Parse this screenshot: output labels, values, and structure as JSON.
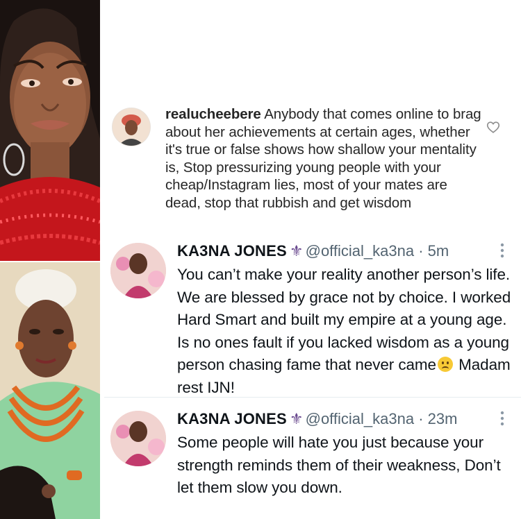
{
  "ig_comment": {
    "username": "realucheebere",
    "text": "Anybody that comes online to brag about her achievements at certain ages, whether it's true or false shows how shallow your mentality is, Stop pressurizing young people with your cheap/Instagram lies, most of your mates are dead, stop that rubbish and get wisdom"
  },
  "tweets": [
    {
      "name": "KA3NA JONES",
      "verified_glyph": "⚜",
      "handle": "@official_ka3na",
      "separator": "·",
      "time": "5m",
      "body_before_emoji": "You can’t make your reality another person’s life. We are blessed by grace not by choice. I worked Hard Smart and built my empire at a young age. Is no ones fault if you lacked wisdom as a young person chasing fame that never came",
      "body_after_emoji": " Madam rest IJN!"
    },
    {
      "name": "KA3NA JONES",
      "verified_glyph": "⚜",
      "handle": "@official_ka3na",
      "separator": "·",
      "time": "23m",
      "body": "Some people will hate you just because your strength reminds them of their weakness, Don’t let them slow you down."
    }
  ],
  "colors": {
    "tweet_text": "#0f1419",
    "tweet_meta": "#536471",
    "ig_text": "#262626",
    "verified_purple": "#6a4a8f"
  }
}
